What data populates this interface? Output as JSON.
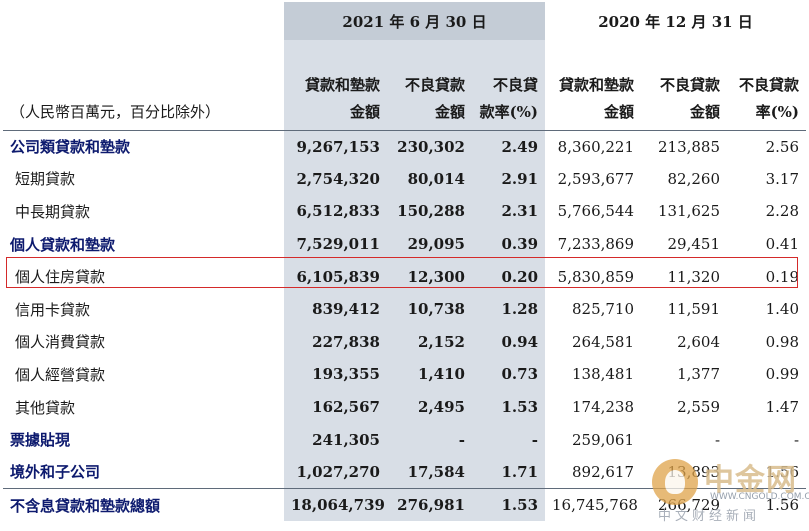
{
  "header": {
    "period_2021": "2021 年 6 月 30 日",
    "period_2020": "2020 年 12 月 31 日",
    "unit_caption": "（人民幣百萬元，百分比除外）",
    "col_loans": "貸款和墊款金額",
    "col_npl": "不良貸款金額",
    "col_ratio": "不良貸款率(%)"
  },
  "rows": [
    {
      "label": "公司類貸款和墊款",
      "a": "9,267,153",
      "b": "230,302",
      "c": "2.49",
      "d": "8,360,221",
      "e": "213,885",
      "f": "2.56"
    },
    {
      "label": "短期貸款",
      "a": "2,754,320",
      "b": "80,014",
      "c": "2.91",
      "d": "2,593,677",
      "e": "82,260",
      "f": "3.17"
    },
    {
      "label": "中長期貸款",
      "a": "6,512,833",
      "b": "150,288",
      "c": "2.31",
      "d": "5,766,544",
      "e": "131,625",
      "f": "2.28"
    },
    {
      "label": "個人貸款和墊款",
      "a": "7,529,011",
      "b": "29,095",
      "c": "0.39",
      "d": "7,233,869",
      "e": "29,451",
      "f": "0.41"
    },
    {
      "label": "個人住房貸款",
      "a": "6,105,839",
      "b": "12,300",
      "c": "0.20",
      "d": "5,830,859",
      "e": "11,320",
      "f": "0.19"
    },
    {
      "label": "信用卡貸款",
      "a": "839,412",
      "b": "10,738",
      "c": "1.28",
      "d": "825,710",
      "e": "11,591",
      "f": "1.40"
    },
    {
      "label": "個人消費貸款",
      "a": "227,838",
      "b": "2,152",
      "c": "0.94",
      "d": "264,581",
      "e": "2,604",
      "f": "0.98"
    },
    {
      "label": "個人經營貸款",
      "a": "193,355",
      "b": "1,410",
      "c": "0.73",
      "d": "138,481",
      "e": "1,377",
      "f": "0.99"
    },
    {
      "label": "其他貸款",
      "a": "162,567",
      "b": "2,495",
      "c": "1.53",
      "d": "174,238",
      "e": "2,559",
      "f": "1.47"
    },
    {
      "label": "票據貼現",
      "a": "241,305",
      "b": "-",
      "c": "-",
      "d": "259,061",
      "e": "-",
      "f": "-"
    },
    {
      "label": "境外和子公司",
      "a": "1,027,270",
      "b": "17,584",
      "c": "1.71",
      "d": "892,617",
      "e": "13,893",
      "f": "1.56"
    },
    {
      "label": "不含息貸款和墊款總額",
      "a": "18,064,739",
      "b": "276,981",
      "c": "1.53",
      "d": "16,745,768",
      "e": "266,729",
      "f": "1.56"
    }
  ],
  "watermark": {
    "name": "中金网",
    "url": "WWW.CNGOLD.COM.CN",
    "subtitle": "中文财经新闻"
  },
  "colors": {
    "highlight_band": "#d8dee6",
    "header_band": "#c4ccd6",
    "category_text": "#0d1a6e",
    "highlight_box": "#d42a2a"
  }
}
